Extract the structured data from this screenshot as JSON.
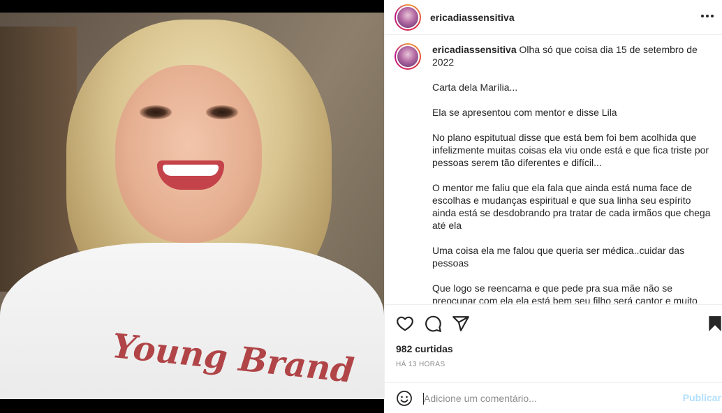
{
  "post": {
    "username": "ericadiassensitiva",
    "photo": {
      "shirt_text": "Young Brand"
    },
    "caption": {
      "username": "ericadiassensitiva",
      "paragraphs": [
        "Olha só que coisa dia 15 de setembro de 2022",
        "Carta dela Marília...",
        "Ela se apresentou com mentor e disse Lila",
        "No plano espitutual disse que está bem foi bem acolhida que infelizmente muitas coisas ela viu onde está e que fica triste por pessoas serem tão diferentes e difícil...",
        "O mentor me faliu que ela fala que ainda está numa face de escolhas e mudanças espiritual e que sua linha seu espírito ainda está se desdobrando pra tratar de cada irmãos que chega até ela",
        "Uma coisa ela me falou que queria ser médica..cuidar das pessoas",
        "Que logo se reencarna e que pede pra sua mãe não se preocupar com ela ela está bem seu filho será cantor e muito conhecido que farás lindas canções de amor"
      ]
    },
    "likes_text": "982 curtidas",
    "time_text": "HÁ 13 HORAS",
    "comment": {
      "placeholder": "Adicione um comentário...",
      "publish_label": "Publicar"
    },
    "icons": {
      "more": "more-options-icon",
      "like": "heart-icon",
      "comment": "comment-icon",
      "share": "paper-plane-icon",
      "save": "bookmark-icon",
      "emoji": "emoji-icon"
    },
    "colors": {
      "publish_disabled": "#b2dffc",
      "secondary_text": "#8e8e8e",
      "shirt_print": "#b04447"
    }
  }
}
